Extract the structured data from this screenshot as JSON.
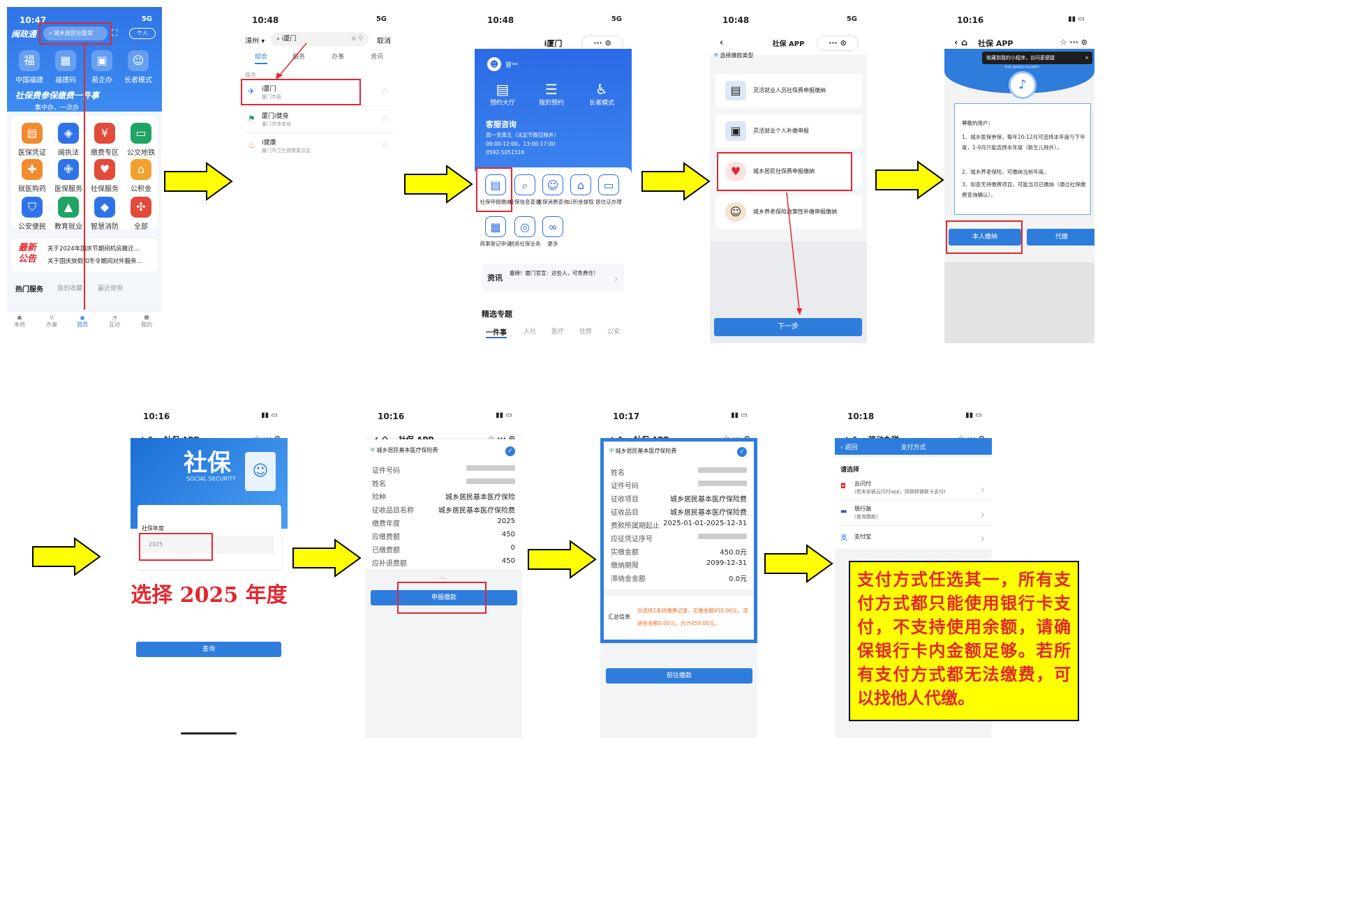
{
  "colors": {
    "blue": "#2e7ddc",
    "red": "#e2272f",
    "yellow": "#ffff00",
    "orange": "#f26b1d"
  },
  "arrows": [
    "arrow-right-icon",
    "arrow-right-icon",
    "arrow-right-icon",
    "arrow-right-icon",
    "arrow-right-icon",
    "arrow-right-icon",
    "arrow-right-icon"
  ],
  "s1": {
    "time": "10:47",
    "signal": "5G",
    "logo": "闽政通",
    "search_placeholder": "城乡居民社医保",
    "profile": "个人",
    "top_icons": [
      "中国福建",
      "福建码",
      "易企办",
      "长者模式"
    ],
    "banner_title": "社保费参保缴费一件事",
    "banner_sub": "集中办、一次办",
    "grid": [
      "医保凭证",
      "闽执法",
      "缴费专区",
      "公交地铁",
      "就医购药",
      "医保服务",
      "社保服务",
      "公积金",
      "公安便民",
      "教育就业",
      "智慧消防",
      "全部"
    ],
    "notice_badge": [
      "最新",
      "公告"
    ],
    "notices": [
      "关于2024年国庆节期间机房搬迁...",
      "关于国庆放假和冬令期间对外服务..."
    ],
    "tabs": [
      "热门服务",
      "我的收藏",
      "最近使用"
    ],
    "bottom_nav": [
      "本地",
      "办事",
      "首页",
      "互动",
      "我的"
    ]
  },
  "s2": {
    "time": "10:48",
    "signal": "5G",
    "city": "漳州",
    "query": "i厦门",
    "cancel": "取消",
    "tabs": [
      "综合",
      "服务",
      "办事",
      "资讯"
    ],
    "section": "服务",
    "results": [
      {
        "name": "i厦门",
        "sub": "厦门市直"
      },
      {
        "name": "厦门i健身",
        "sub": "厦门市体育局"
      },
      {
        "name": "i健康",
        "sub": "厦门市卫生健康委员会"
      }
    ]
  },
  "s3": {
    "time": "10:48",
    "signal": "5G",
    "title": "i厦门",
    "user": "曾**",
    "quick": [
      "预约大厅",
      "我的预约",
      "长者模式"
    ],
    "service_title": "客服咨询",
    "service_hours": "周一至周五（法定节假日除外）",
    "service_time": "09:00-12:00，13:00-17:00",
    "service_phone": "0592-5051516",
    "grid": [
      "社保申报缴纳",
      "社保信息查询",
      "医保消费查询",
      "公积金提取",
      "居住证办理",
      "商事登记申请",
      "税务社保业务",
      "更多"
    ],
    "news_tag": "资讯",
    "news": "重磅！厦门官宣：这些人，可免费住！",
    "topic_title": "精选专题",
    "topic_tabs": [
      "一件事",
      "人社",
      "医疗",
      "住房",
      "公安"
    ]
  },
  "s4": {
    "time": "10:48",
    "signal": "5G",
    "title": "社保 APP",
    "section": "选择缴款类型",
    "options": [
      "灵活就业人员社保费申报缴纳",
      "灵活就业个人补缴申报",
      "城乡居民社保费申报缴纳",
      "城乡养老保险政策性补缴申报缴纳"
    ],
    "next": "下一步"
  },
  "s5": {
    "time": "10:16",
    "title": "社保 APP",
    "tooltip": "收藏到我的小程序，访问更便捷",
    "warm": "THE WARM PROMPT",
    "greeting": "尊敬的用户：",
    "items": [
      "1、城乡医保参保，每年10-12月可选择本年度与下年度，1-9月只能选择本年度（新生儿除外）。",
      "2、城乡养老保险，可缴纳当前年度。",
      "3、如查无待缴费项目，可能当月已缴纳（通过社保缴费查询确认）。"
    ],
    "btn_self": "本人缴纳",
    "btn_proxy": "代缴"
  },
  "s6": {
    "time": "10:16",
    "title": "社保 APP",
    "banner": "社保",
    "banner_en": "SOCIAL SECURITY",
    "year_label": "社保年度",
    "year_value": "2025",
    "query": "查询",
    "annotation": "选择 2025 年度"
  },
  "s7": {
    "time": "10:16",
    "title": "社保 APP",
    "header": "城乡居民基本医疗保险费",
    "rows": [
      {
        "k": "证件号码",
        "v": ""
      },
      {
        "k": "姓名",
        "v": ""
      },
      {
        "k": "险种",
        "v": "城乡居民基本医疗保险"
      },
      {
        "k": "征收品目名称",
        "v": "城乡居民基本医疗保险费"
      },
      {
        "k": "缴费年度",
        "v": "2025"
      },
      {
        "k": "应缴费额",
        "v": "450"
      },
      {
        "k": "已缴费额",
        "v": "0"
      },
      {
        "k": "应补退费额",
        "v": "450"
      }
    ],
    "submit": "申报缴款"
  },
  "s8": {
    "time": "10:17",
    "title": "社保 APP",
    "header": "城乡居民基本医疗保险费",
    "rows": [
      {
        "k": "姓名",
        "v": ""
      },
      {
        "k": "证件号码",
        "v": ""
      },
      {
        "k": "征收项目",
        "v": "城乡居民基本医疗保险费"
      },
      {
        "k": "征收品目",
        "v": "城乡居民基本医疗保险费"
      },
      {
        "k": "费款所属期起止",
        "v": "2025-01-01-2025-12-31"
      },
      {
        "k": "应征凭证序号",
        "v": ""
      },
      {
        "k": "实缴金额",
        "v": "450.0元"
      },
      {
        "k": "缴纳期限",
        "v": "2099-12-31"
      },
      {
        "k": "滞纳金金额",
        "v": "0.0元"
      }
    ],
    "summary_label": "汇总信息",
    "summary_text": "共选择1条待缴费记录，实缴金额450.00元，滞纳金金额0.00元，合计450.00元。",
    "go": "前往缴款"
  },
  "s9": {
    "time": "10:18",
    "title": "移动办税",
    "back": "返回",
    "header": "支付方式",
    "choose": "请选择",
    "methods": [
      {
        "name": "云闪付",
        "sub": "(若未安装云闪付app，则跳转银联卡支付)"
      },
      {
        "name": "银行端",
        "sub": "(查询缴款)"
      },
      {
        "name": "支付宝",
        "sub": ""
      }
    ],
    "note": "支付方式任选其一，所有支付方式都只能使用银行卡支付，不支持使用余额，请确保银行卡内金额足够。若所有支付方式都无法缴费，可以找他人代缴。"
  }
}
